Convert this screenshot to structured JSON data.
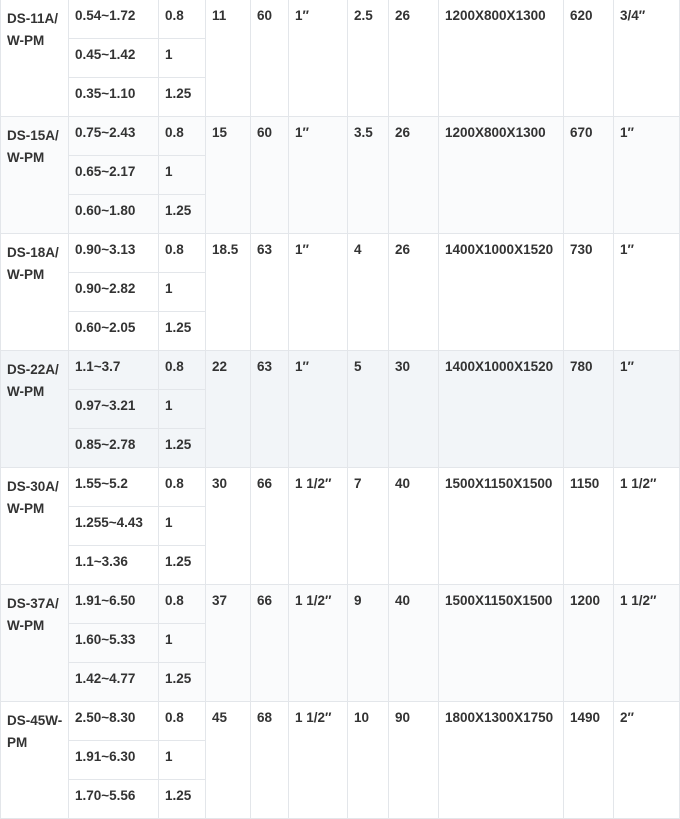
{
  "rows": [
    {
      "model": "DS-11A/W-PM",
      "sub": [
        {
          "flow": "0.54~1.72",
          "pressure": "0.8"
        },
        {
          "flow": "0.45~1.42",
          "pressure": "1"
        },
        {
          "flow": "0.35~1.10",
          "pressure": "1.25"
        }
      ],
      "power": "11",
      "noise": "60",
      "outlet": "1″",
      "cooling": "2.5",
      "fan": "26",
      "dimension": "1200X800X1300",
      "weight": "620",
      "drain": "3/4″"
    },
    {
      "model": "DS-15A/W-PM",
      "sub": [
        {
          "flow": "0.75~2.43",
          "pressure": "0.8"
        },
        {
          "flow": "0.65~2.17",
          "pressure": "1"
        },
        {
          "flow": "0.60~1.80",
          "pressure": "1.25"
        }
      ],
      "power": "15",
      "noise": "60",
      "outlet": "1″",
      "cooling": "3.5",
      "fan": "26",
      "dimension": "1200X800X1300",
      "weight": "670",
      "drain": "1″"
    },
    {
      "model": "DS-18A/W-PM",
      "sub": [
        {
          "flow": "0.90~3.13",
          "pressure": "0.8"
        },
        {
          "flow": "0.90~2.82",
          "pressure": "1"
        },
        {
          "flow": "0.60~2.05",
          "pressure": "1.25"
        }
      ],
      "power": "18.5",
      "noise": "63",
      "outlet": "1″",
      "cooling": "4",
      "fan": "26",
      "dimension": "1400X1000X1520",
      "weight": "730",
      "drain": "1″"
    },
    {
      "model": "DS-22A/W-PM",
      "sub": [
        {
          "flow": "1.1~3.7",
          "pressure": "0.8"
        },
        {
          "flow": "0.97~3.21",
          "pressure": "1"
        },
        {
          "flow": "0.85~2.78",
          "pressure": "1.25"
        }
      ],
      "power": "22",
      "noise": "63",
      "outlet": "1″",
      "cooling": "5",
      "fan": "30",
      "dimension": "1400X1000X1520",
      "weight": "780",
      "drain": "1″"
    },
    {
      "model": "DS-30A/W-PM",
      "sub": [
        {
          "flow": "1.55~5.2",
          "pressure": "0.8"
        },
        {
          "flow": "1.255~4.43",
          "pressure": "1"
        },
        {
          "flow": "1.1~3.36",
          "pressure": "1.25"
        }
      ],
      "power": "30",
      "noise": "66",
      "outlet": "1 1/2″",
      "cooling": "7",
      "fan": "40",
      "dimension": "1500X1150X1500",
      "weight": "1150",
      "drain": "1 1/2″"
    },
    {
      "model": "DS-37A/W-PM",
      "sub": [
        {
          "flow": "1.91~6.50",
          "pressure": "0.8"
        },
        {
          "flow": "1.60~5.33",
          "pressure": "1"
        },
        {
          "flow": "1.42~4.77",
          "pressure": "1.25"
        }
      ],
      "power": "37",
      "noise": "66",
      "outlet": "1 1/2″",
      "cooling": "9",
      "fan": "40",
      "dimension": "1500X1150X1500",
      "weight": "1200",
      "drain": "1 1/2″"
    },
    {
      "model": "DS-45W-PM",
      "sub": [
        {
          "flow": "2.50~8.30",
          "pressure": "0.8"
        },
        {
          "flow": "1.91~6.30",
          "pressure": "1"
        },
        {
          "flow": "1.70~5.56",
          "pressure": "1.25"
        }
      ],
      "power": "45",
      "noise": "68",
      "outlet": "1 1/2″",
      "cooling": "10",
      "fan": "90",
      "dimension": "1800X1300X1750",
      "weight": "1490",
      "drain": "2″"
    }
  ]
}
